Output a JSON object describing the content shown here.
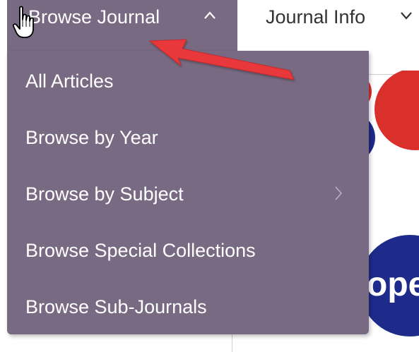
{
  "nav": {
    "browse_journal": "Browse Journal",
    "journal_info": "Journal Info"
  },
  "dropdown": {
    "items": [
      {
        "label": "All Articles"
      },
      {
        "label": "Browse by Year"
      },
      {
        "label": "Browse by Subject",
        "has_submenu": true
      },
      {
        "label": "Browse Special Collections"
      },
      {
        "label": "Browse Sub-Journals"
      }
    ]
  },
  "background": {
    "partial_logo_text": "ope"
  },
  "colors": {
    "menu_bg": "#786a82",
    "arrow": "#e8383a",
    "logo_red": "#d9302c",
    "logo_blue": "#1f2b8a"
  },
  "icons": {
    "browse_caret": "chevron-up-icon",
    "info_caret": "chevron-down-icon",
    "submenu": "chevron-right-icon",
    "cursor": "hand-pointer-icon",
    "annotation": "red-arrow-icon"
  }
}
